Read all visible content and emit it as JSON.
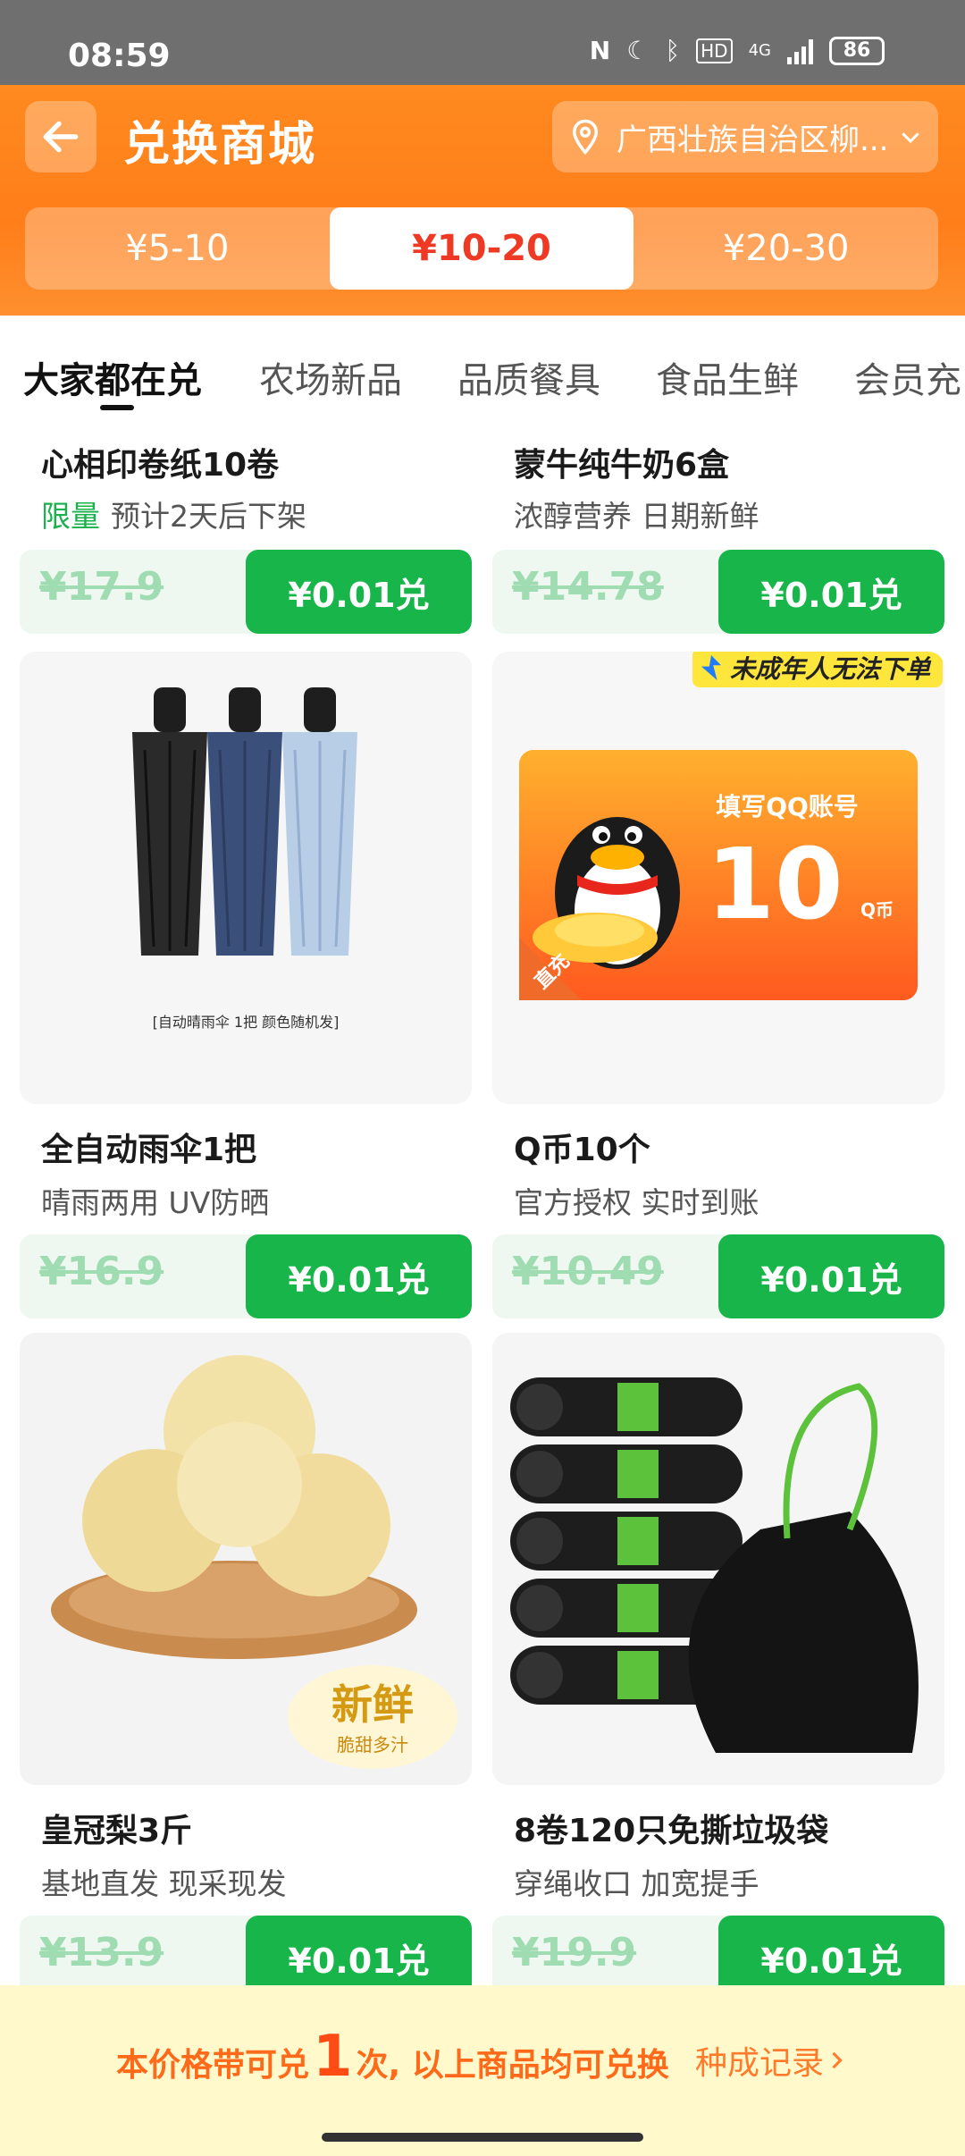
{
  "status": {
    "time": "08:59",
    "battery": "86",
    "network": "4G"
  },
  "header": {
    "title": "兑换商城",
    "location": "广西壮族自治区柳...",
    "price_tabs": [
      {
        "label": "¥5-10",
        "active": false
      },
      {
        "label": "¥10-20",
        "active": true
      },
      {
        "label": "¥20-30",
        "active": false
      }
    ]
  },
  "categories": [
    "大家都在兑",
    "农场新品",
    "品质餐具",
    "食品生鲜",
    "会员充"
  ],
  "products": [
    {
      "name": "心相印卷纸10卷",
      "tag": "限量",
      "desc": "预计2天后下架",
      "orig_price": "¥17.9",
      "exchange": "¥0.01兑"
    },
    {
      "name": "蒙牛纯牛奶6盒",
      "tag": "",
      "desc": "浓醇营养 日期新鲜",
      "orig_price": "¥14.78",
      "exchange": "¥0.01兑"
    },
    {
      "name": "全自动雨伞1把",
      "tag": "",
      "desc": "晴雨两用 UV防晒",
      "orig_price": "¥16.9",
      "exchange": "¥0.01兑",
      "img_caption": "[自动晴雨伞 1把 颜色随机发]"
    },
    {
      "name": "Q币10个",
      "tag": "",
      "desc": "官方授权 实时到账",
      "orig_price": "¥10.49",
      "exchange": "¥0.01兑",
      "badge": "未成年人无法下单",
      "card_text": "填写QQ账号",
      "card_amount": "10",
      "card_unit": "Q币",
      "card_corner": "直充"
    },
    {
      "name": "皇冠梨3斤",
      "tag": "",
      "desc": "基地直发 现采现发",
      "orig_price": "¥13.9",
      "exchange": "¥0.01兑",
      "img_badge_title": "新鲜",
      "img_badge_sub": "脆甜多汁"
    },
    {
      "name": "8卷120只免撕垃圾袋",
      "tag": "",
      "desc": "穿绳收口 加宽提手",
      "orig_price": "¥19.9",
      "exchange": "¥0.01兑"
    }
  ],
  "footer": {
    "msg_pre": "本价格带可兑",
    "msg_num": "1",
    "msg_post": "次, 以上商品均可兑换",
    "record": "种成记录"
  },
  "colors": {
    "orange": "#ff7e1a",
    "green": "#18b54a",
    "red": "#ee3a25"
  }
}
